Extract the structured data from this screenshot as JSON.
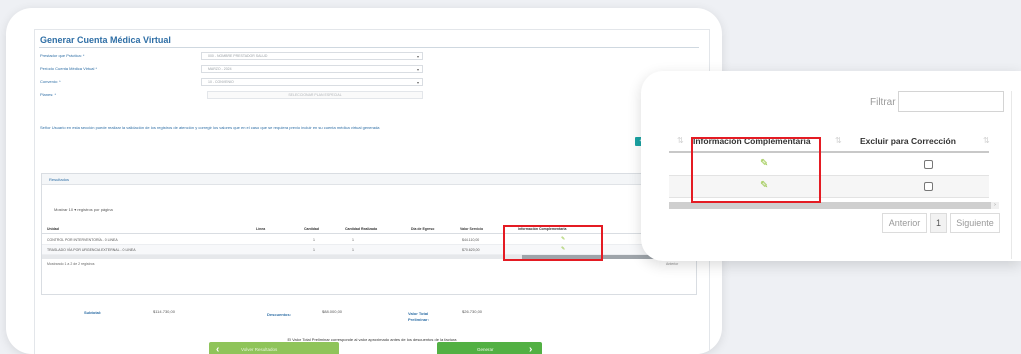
{
  "form": {
    "title": "Generar Cuenta Médica Virtual",
    "fields": [
      {
        "label": "Prestador que Práctica: *",
        "value": "000 - NOMBRE PRESTADOR SALUD"
      },
      {
        "label": "Período Cuenta Médica Virtual *",
        "value": "MARZO - 2024"
      },
      {
        "label": "Convenio: *",
        "value": "10 - CONVENIO"
      },
      {
        "label": "Planes: *",
        "value": "SELECCIONAR PLAN ESPECIAL"
      }
    ],
    "note": "Señor Usuario en esta sección puede realizar la validación de los registros de atención y corregir los valores que en el caso que se requiera previo incluir en su cuenta médica virtual generada",
    "add_button_icon": "plus-icon"
  },
  "results": {
    "title": "Resultados",
    "show_label": "Mostrar 10 ▾ registros por página",
    "filter_label": "Filtro",
    "columns": [
      "Unidad",
      "Línea",
      "Cantidad",
      "Cantidad Realizada",
      "Día de Egreso",
      "Valor Servicio",
      "Información Complementaria",
      "Excluir para"
    ],
    "rows": [
      {
        "unidad": "CONTROL POR INTERVENTORÍA - 0 LINEA",
        "cantidad": "1",
        "realizada": "1",
        "valor": "$44.110,00"
      },
      {
        "unidad": "TRASLADO VÍA POR URGENCIA EXTERNAL - 0 LINEA",
        "cantidad": "1",
        "realizada": "1",
        "valor": "$70.620,00"
      }
    ],
    "showing": "Mostrando 1 a 2 de 2 registros",
    "prev": "Anterior"
  },
  "totals": {
    "subtotal_label": "Subtotal:",
    "subtotal_value": "$114.730,00",
    "discount_label": "Descuentos:",
    "discount_value": "$88.000,00",
    "total_label": "Valor Total Preliminar:",
    "total_value": "$26.730,00"
  },
  "footnote": "El Valor Total Preliminar corresponde al valor aproximado antes de los descuentos de la factura",
  "buttons": {
    "back": "Volver Resultados",
    "next": "Generar"
  },
  "zoom": {
    "filter_label": "Filtrar",
    "filter_value": "",
    "col_info": "Información Complementaria",
    "col_exclude": "Excluir para Corrección",
    "prev": "Anterior",
    "page": "1",
    "next": "Siguiente"
  },
  "colors": {
    "accent": "#2f6fa6",
    "highlight": "#e41b23",
    "pencil": "#8bbf2f",
    "button_green": "#52b043"
  }
}
